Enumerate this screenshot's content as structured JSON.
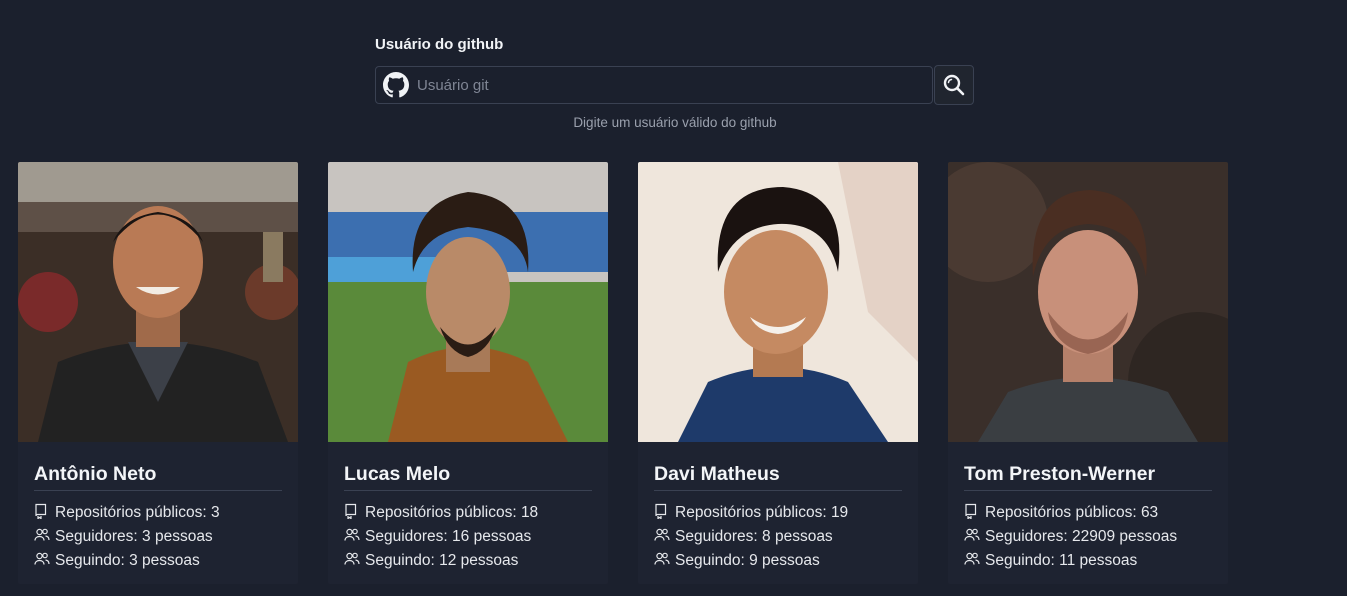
{
  "search": {
    "label": "Usuário do github",
    "placeholder": "Usuário git",
    "hint": "Digite um usuário válido do github",
    "icon": "github-icon",
    "button_icon": "search-icon"
  },
  "users": [
    {
      "name": "Antônio Neto",
      "repos": "Repositórios públicos: 3",
      "followers": "Seguidores: 3 pessoas",
      "following": "Seguindo: 3 pessoas"
    },
    {
      "name": "Lucas Melo",
      "repos": "Repositórios públicos: 18",
      "followers": "Seguidores: 16 pessoas",
      "following": "Seguindo: 12 pessoas"
    },
    {
      "name": "Davi Matheus",
      "repos": "Repositórios públicos: 19",
      "followers": "Seguidores: 8 pessoas",
      "following": "Seguindo: 9 pessoas"
    },
    {
      "name": "Tom Preston-Werner",
      "repos": "Repositórios públicos: 63",
      "followers": "Seguidores: 22909 pessoas",
      "following": "Seguindo: 11 pessoas"
    }
  ],
  "colors": {
    "background": "#1b202d",
    "card": "#1e2331",
    "border": "#3a4152"
  }
}
